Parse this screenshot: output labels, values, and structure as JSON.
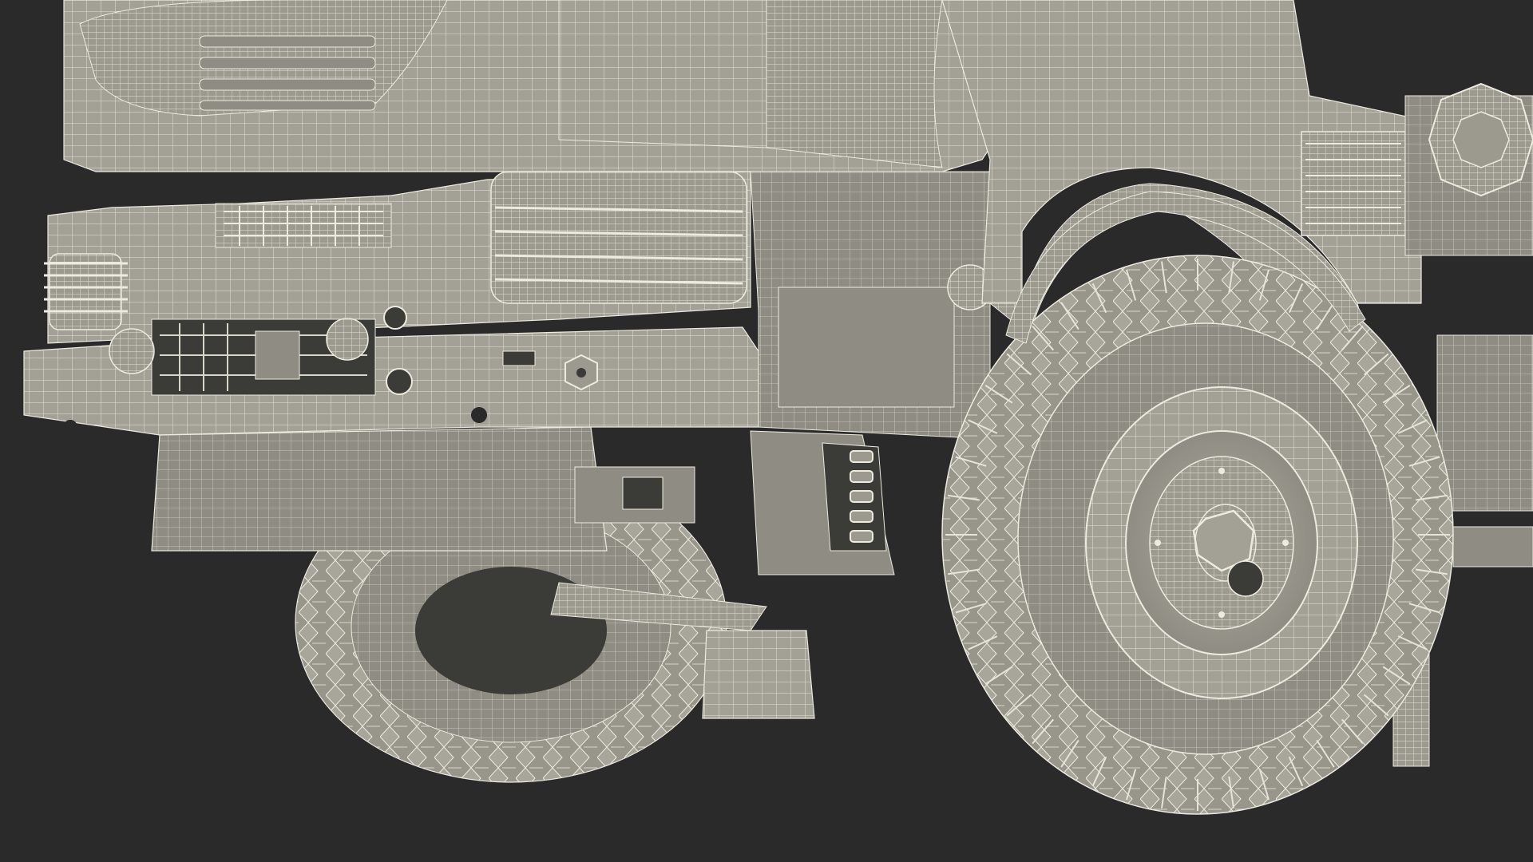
{
  "scene": {
    "background_color": "#2a2a2a",
    "model_fill_color": "#a3a196",
    "wire_color": "#e6e4d8",
    "dark_cavity_color": "#3b3b37",
    "icon_names": [
      "truck-front-wireframe-icon",
      "wheel-icon",
      "tire-tread-icon"
    ]
  }
}
